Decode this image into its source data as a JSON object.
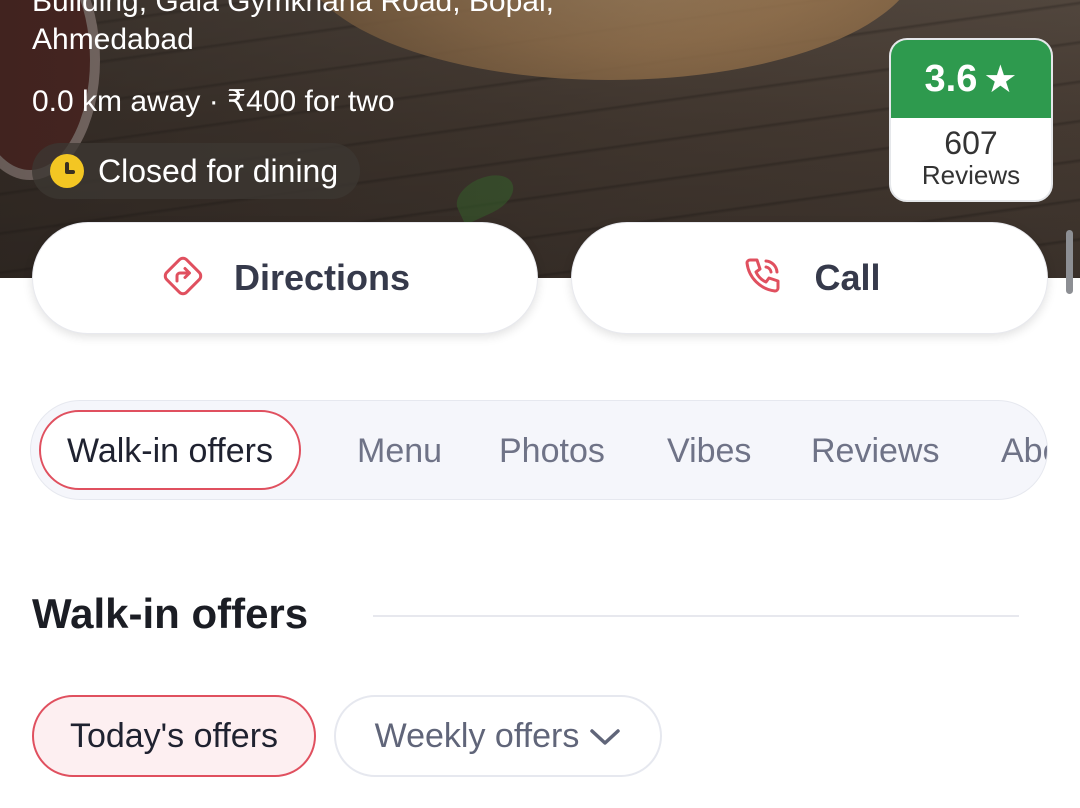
{
  "restaurant": {
    "address_line1": "Building, Gala Gymkhana Road, Bopal,",
    "address_line2": "Ahmedabad",
    "distance_price": "0.0 km away · ₹400 for two",
    "status": "Closed for dining"
  },
  "rating": {
    "score": "3.6",
    "star": "★",
    "count": "607",
    "count_label": "Reviews",
    "color": "#2e9a4e"
  },
  "actions": {
    "directions_label": "Directions",
    "call_label": "Call",
    "accent_color": "#e0505f"
  },
  "tabs": [
    {
      "label": "Walk-in offers",
      "active": true
    },
    {
      "label": "Menu"
    },
    {
      "label": "Photos"
    },
    {
      "label": "Vibes"
    },
    {
      "label": "Reviews"
    },
    {
      "label": "About"
    }
  ],
  "section": {
    "title": "Walk-in offers"
  },
  "offer_filters": {
    "today_label": "Today's offers",
    "weekly_label": "Weekly offers"
  }
}
